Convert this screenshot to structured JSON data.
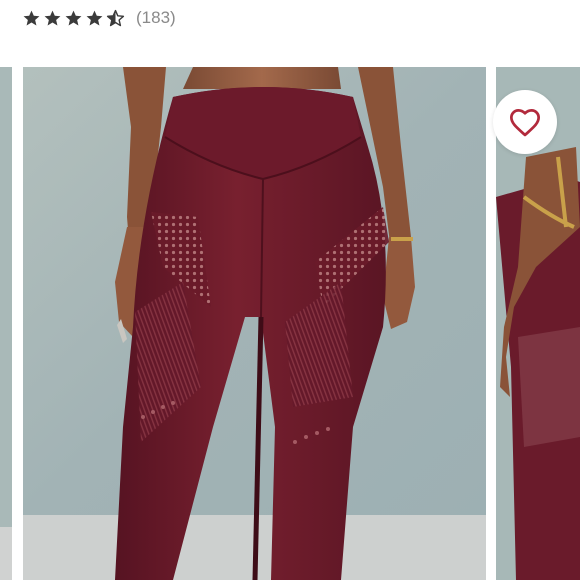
{
  "product": {
    "rating": 4.5,
    "rating_max": 5,
    "review_count_text": "(183)"
  },
  "colors": {
    "star": "#3b3b3b",
    "review_count": "#8a8a8a",
    "legging": "#6e1a2b",
    "heart": "#b22a3c",
    "backdrop": "#a6b7b6",
    "floor": "#cfd1d0"
  },
  "icons": {
    "star": "star-icon",
    "half_star": "half-star-icon",
    "favorite": "heart-icon"
  },
  "gallery": {
    "current_index": 2
  }
}
